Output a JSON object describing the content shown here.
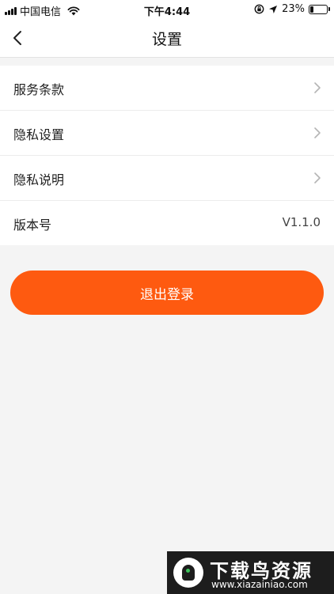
{
  "status_bar": {
    "carrier": "中国电信",
    "time": "下午4:44",
    "battery_percent": "23%",
    "battery_level": 0.23,
    "icons": [
      "signal-icon",
      "wifi-icon",
      "orientation-lock-icon",
      "location-icon",
      "battery-icon"
    ]
  },
  "nav": {
    "back_icon": "chevron-left-icon",
    "title": "设置"
  },
  "settings": {
    "items": [
      {
        "label": "服务条款",
        "icon": "chevron-right-icon"
      },
      {
        "label": "隐私设置",
        "icon": "chevron-right-icon"
      },
      {
        "label": "隐私说明",
        "icon": "chevron-right-icon"
      },
      {
        "label": "版本号",
        "value": "V1.1.0"
      }
    ]
  },
  "logout": {
    "label": "退出登录"
  },
  "watermark": {
    "title": "下载鸟资源",
    "url": "www.xiazainiao.com"
  },
  "colors": {
    "accent": "#fe5a10",
    "background": "#f4f4f4",
    "surface": "#ffffff"
  }
}
